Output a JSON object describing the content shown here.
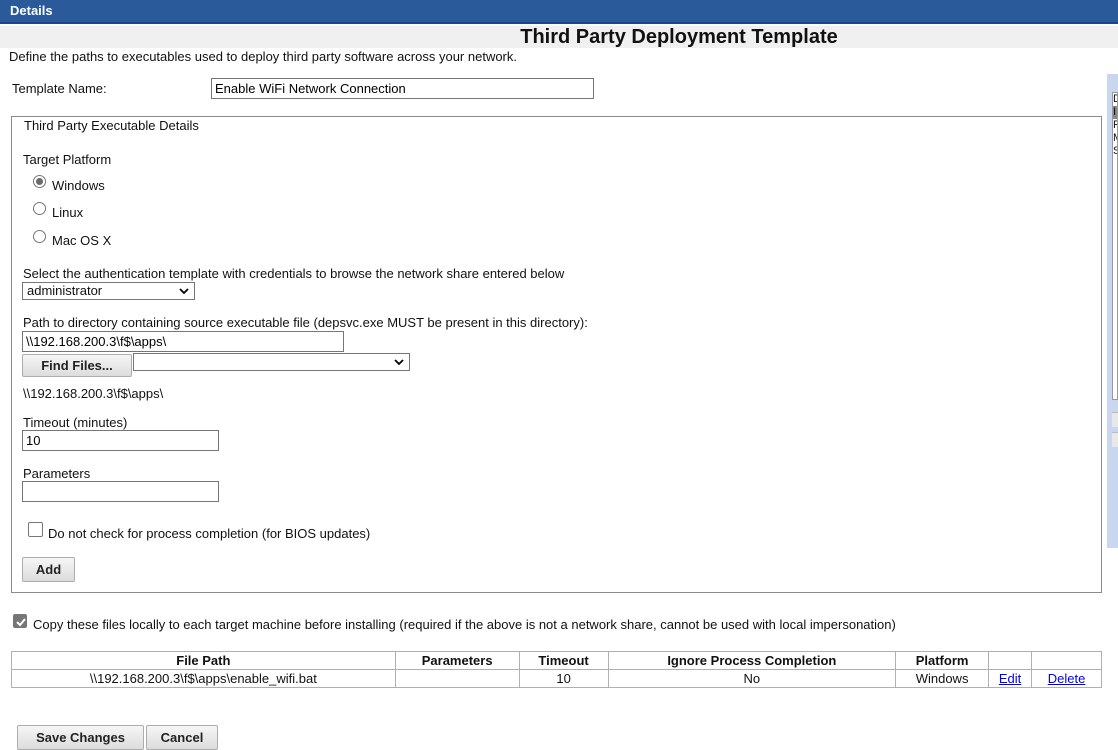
{
  "header": {
    "label": "Details"
  },
  "page": {
    "title": "Third Party Deployment Template",
    "intro": "Define the paths to executables used to deploy third party software across your network."
  },
  "template": {
    "label": "Template Name:",
    "value": "Enable WiFi Network Connection"
  },
  "fieldset": {
    "legend": "Third Party Executable Details"
  },
  "platform": {
    "label": "Target Platform",
    "options": [
      "Windows",
      "Linux",
      "Mac OS X"
    ],
    "selected": "Windows"
  },
  "auth": {
    "label": "Select the authentication template with credentials to browse the network share entered below",
    "selected": "administrator"
  },
  "path": {
    "label": "Path to directory containing source executable file (depsvc.exe MUST be present in this directory):",
    "value": "\\\\192.168.200.3\\f$\\apps\\",
    "find_button": "Find Files...",
    "file_select_value": "",
    "display": "\\\\192.168.200.3\\f$\\apps\\"
  },
  "timeout": {
    "label": "Timeout (minutes)",
    "value": "10"
  },
  "parameters": {
    "label": "Parameters",
    "value": ""
  },
  "no_check": {
    "label": "Do not check for process completion (for BIOS updates)",
    "checked": false
  },
  "add_button": "Add",
  "copy_local": {
    "label": "Copy these files locally to each target machine before installing (required if the above is not a network share, cannot be used with local impersonation)",
    "checked": true
  },
  "table": {
    "headers": [
      "File Path",
      "Parameters",
      "Timeout",
      "Ignore Process Completion",
      "Platform",
      "",
      ""
    ],
    "rows": [
      {
        "file_path": "\\\\192.168.200.3\\f$\\apps\\enable_wifi.bat",
        "parameters": "",
        "timeout": "10",
        "ignore": "No",
        "platform": "Windows",
        "edit": "Edit",
        "delete": "Delete"
      }
    ]
  },
  "actions": {
    "save": "Save Changes",
    "cancel": "Cancel"
  },
  "side_list": {
    "items": [
      "D",
      "I",
      "F",
      "M",
      "S"
    ]
  }
}
